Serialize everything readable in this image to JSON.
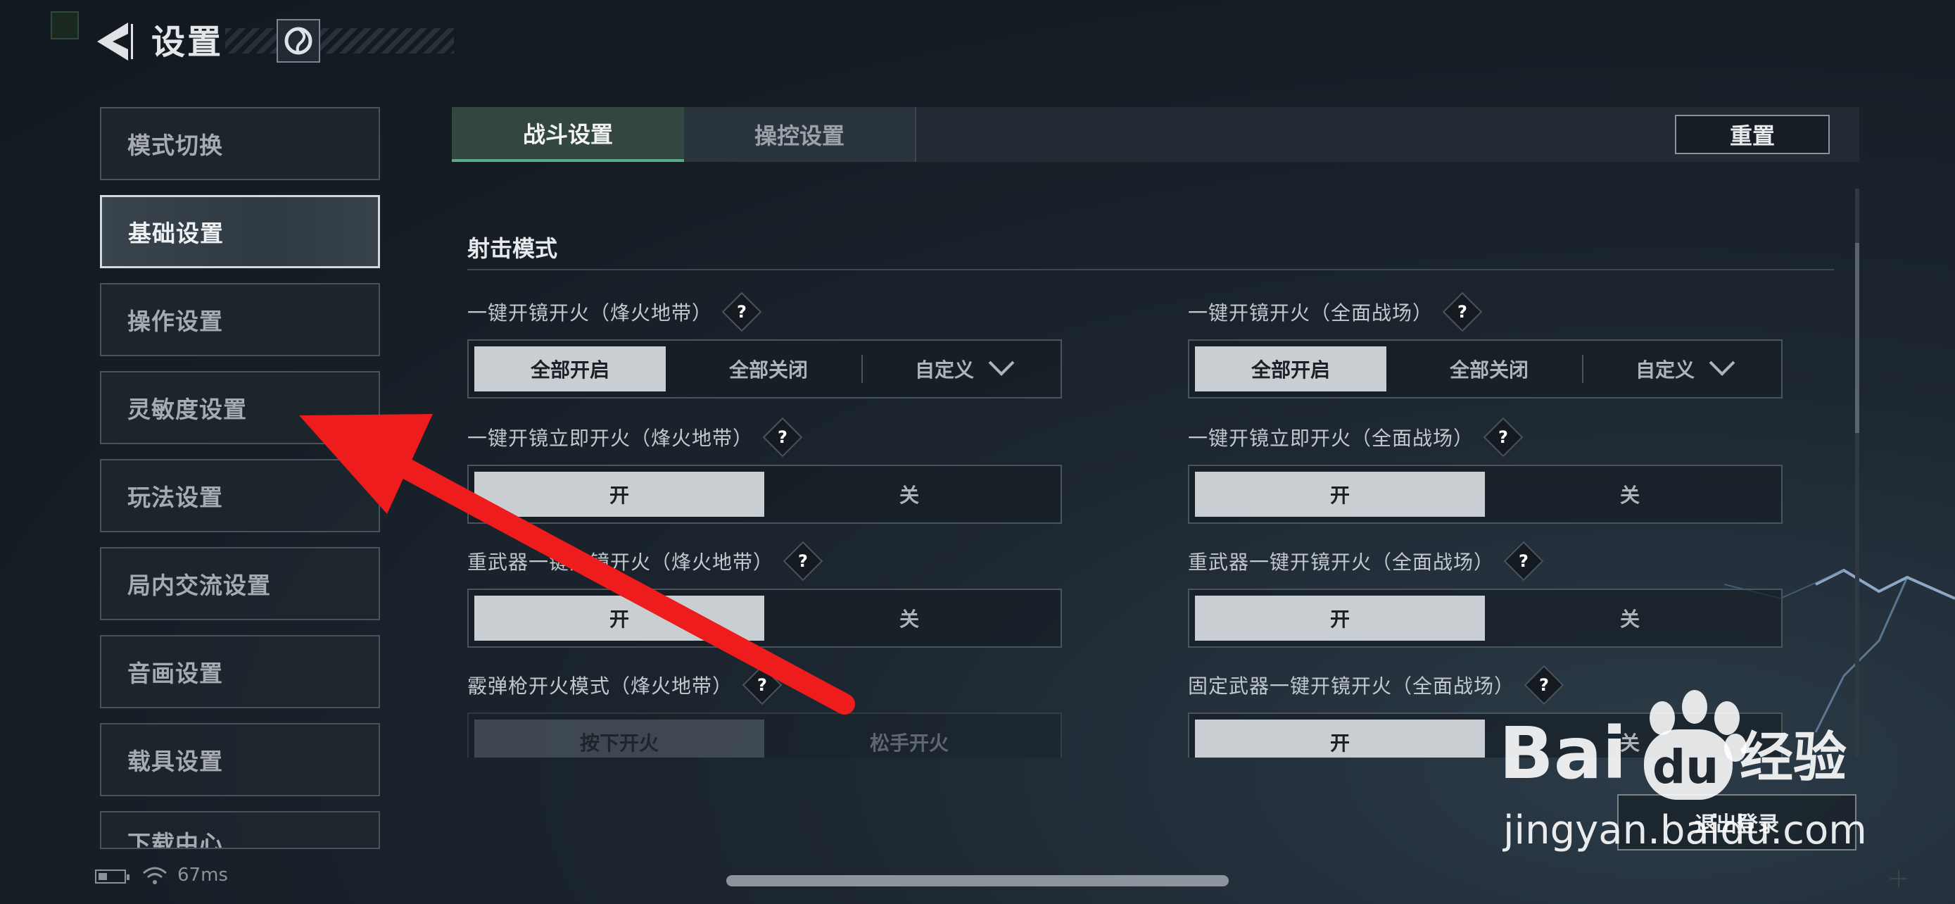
{
  "header": {
    "title": "设置"
  },
  "sidebar": {
    "items": [
      {
        "label": "模式切换"
      },
      {
        "label": "基础设置"
      },
      {
        "label": "操作设置"
      },
      {
        "label": "灵敏度设置"
      },
      {
        "label": "玩法设置"
      },
      {
        "label": "局内交流设置"
      },
      {
        "label": "音画设置"
      },
      {
        "label": "载具设置"
      },
      {
        "label": "下载中心"
      }
    ],
    "active_index": 1
  },
  "tabs": [
    {
      "label": "战斗设置"
    },
    {
      "label": "操控设置"
    }
  ],
  "reset_label": "重置",
  "section": {
    "title": "射击模式"
  },
  "settings": {
    "left": [
      {
        "label": "一键开镜开火（烽火地带）",
        "options": [
          "全部开启",
          "全部关闭",
          "自定义"
        ]
      },
      {
        "label": "一键开镜立即开火（烽火地带）",
        "options": [
          "开",
          "关"
        ]
      },
      {
        "label": "重武器一键开镜开火（烽火地带）",
        "options": [
          "开",
          "关"
        ]
      },
      {
        "label": "霰弹枪开火模式（烽火地带）",
        "options": [
          "按下开火",
          "松手开火"
        ]
      }
    ],
    "right": [
      {
        "label": "一键开镜开火（全面战场）",
        "options": [
          "全部开启",
          "全部关闭",
          "自定义"
        ]
      },
      {
        "label": "一键开镜立即开火（全面战场）",
        "options": [
          "开",
          "关"
        ]
      },
      {
        "label": "重武器一键开镜开火（全面战场）",
        "options": [
          "开",
          "关"
        ]
      },
      {
        "label": "固定武器一键开镜开火（全面战场）",
        "options": [
          "开",
          "关"
        ]
      }
    ],
    "help_glyph": "?"
  },
  "status": {
    "ping": "67ms"
  },
  "logout_label": "退出登录",
  "watermark": {
    "brand": "Bai",
    "brand_du": "du",
    "suffix": "经验",
    "url": "jingyan.baidu.com"
  },
  "colors": {
    "accent": "#5da88b",
    "annotation_arrow": "#ee1c1c"
  }
}
